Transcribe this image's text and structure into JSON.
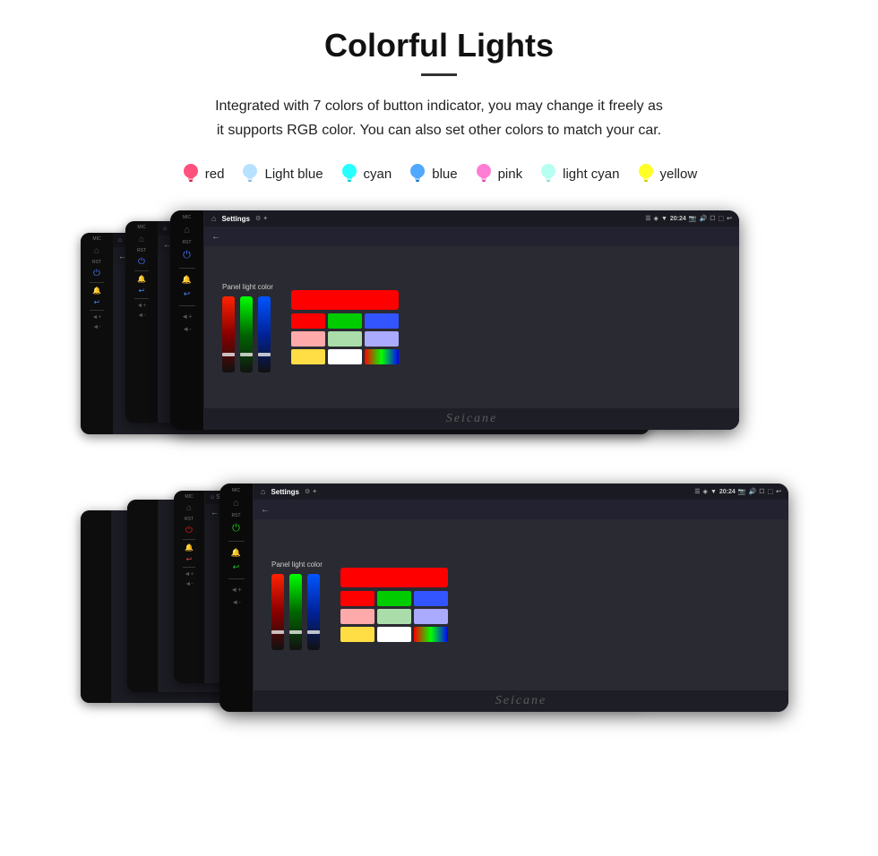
{
  "title": "Colorful Lights",
  "description": "Integrated with 7 colors of button indicator, you may change it freely as\nit supports RGB color. You can also set other colors to match your car.",
  "colors": [
    {
      "name": "red",
      "hex": "#ff3366",
      "bulb": "🔴"
    },
    {
      "name": "Light blue",
      "hex": "#99ccff",
      "bulb": "💡"
    },
    {
      "name": "cyan",
      "hex": "#00ffff",
      "bulb": "💡"
    },
    {
      "name": "blue",
      "hex": "#3399ff",
      "bulb": "💡"
    },
    {
      "name": "pink",
      "hex": "#ff66cc",
      "bulb": "💡"
    },
    {
      "name": "light cyan",
      "hex": "#aaffee",
      "bulb": "💡"
    },
    {
      "name": "yellow",
      "hex": "#ffff00",
      "bulb": "💡"
    }
  ],
  "screen": {
    "title": "Settings",
    "time": "20:24",
    "panel_label": "Panel light color",
    "nav_back": "←"
  },
  "watermark": "Seicane",
  "color_grid": [
    [
      "#ff0000",
      "#00dd00",
      "#4466ff"
    ],
    [
      "#ff9999",
      "#99dd99",
      "#9999ff"
    ],
    [
      "#ffdd66",
      "#ffffff",
      "#ff44ff"
    ]
  ]
}
